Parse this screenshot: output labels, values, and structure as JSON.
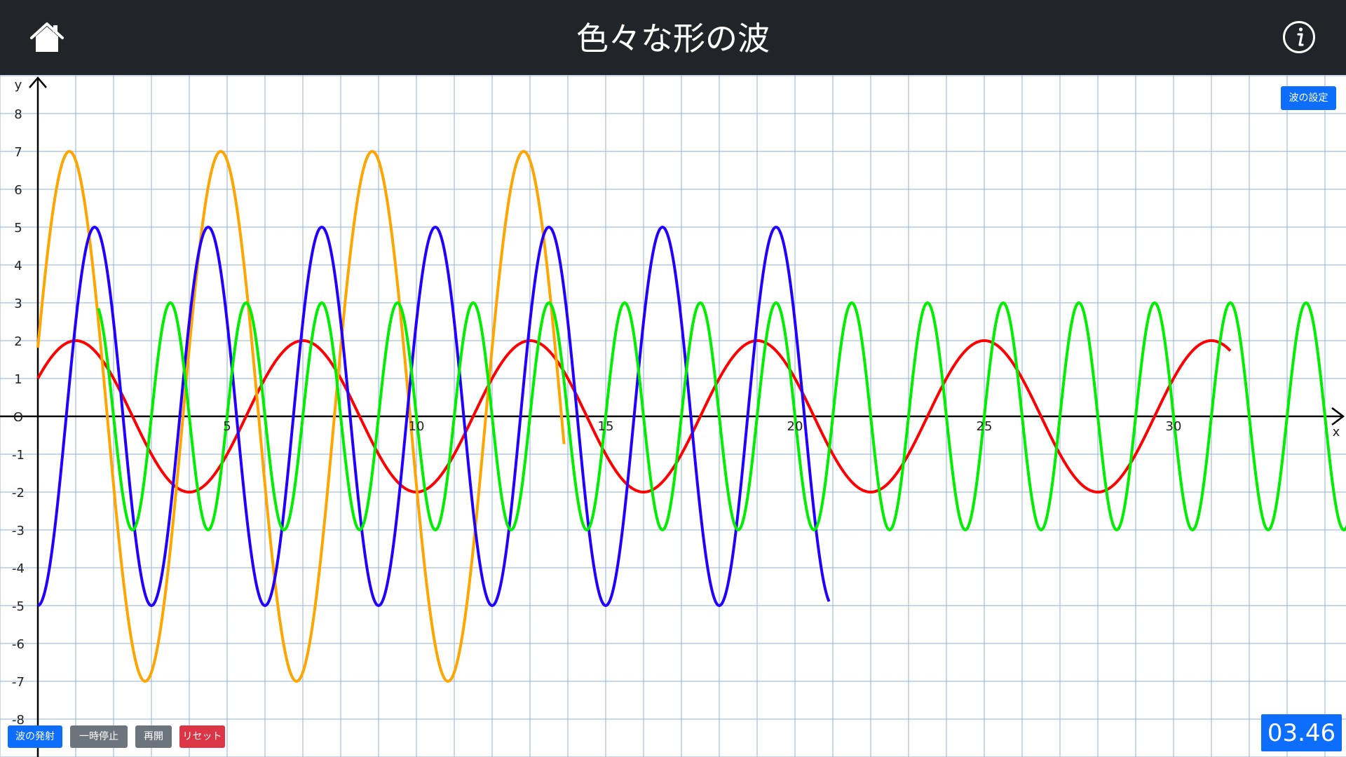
{
  "header": {
    "title": "色々な形の波",
    "home_icon": "home-icon",
    "info_icon": "info-icon",
    "bg_color": "#212529"
  },
  "controls": {
    "settings_label": "波の設定",
    "launch_label": "波の発射",
    "pause_label": "一時停止",
    "resume_label": "再開",
    "reset_label": "リセット"
  },
  "timer": {
    "value": "03.46"
  },
  "chart_data": {
    "type": "line",
    "xlabel": "x",
    "ylabel": "y",
    "origin_label": "O",
    "xlim": [
      0,
      34.7
    ],
    "ylim": [
      -9,
      9
    ],
    "x_ticks": [
      5,
      10,
      15,
      20,
      25,
      30
    ],
    "y_ticks": [
      8,
      7,
      6,
      5,
      4,
      3,
      2,
      1,
      -1,
      -2,
      -3,
      -4,
      -5,
      -6,
      -7,
      -8
    ],
    "grid": true,
    "grid_step": 1,
    "grid_color": "#8fb0dd",
    "series": [
      {
        "color": "#ff0000",
        "amplitude": 2,
        "wavelength": 6,
        "phase_deg": 30,
        "x_start": 0,
        "x_end": 31.5
      },
      {
        "color": "#ffa500",
        "amplitude": 7,
        "wavelength": 4,
        "phase_deg": 15,
        "x_start": 0,
        "x_end": 13.9
      },
      {
        "color": "#2200ff",
        "amplitude": 5,
        "wavelength": 3,
        "phase_deg": -90,
        "x_start": 0,
        "x_end": 20.9
      },
      {
        "color": "#00ee00",
        "amplitude": 3,
        "wavelength": 2,
        "phase_deg": 180,
        "x_start": 1.6,
        "x_end": 34.7
      }
    ]
  }
}
